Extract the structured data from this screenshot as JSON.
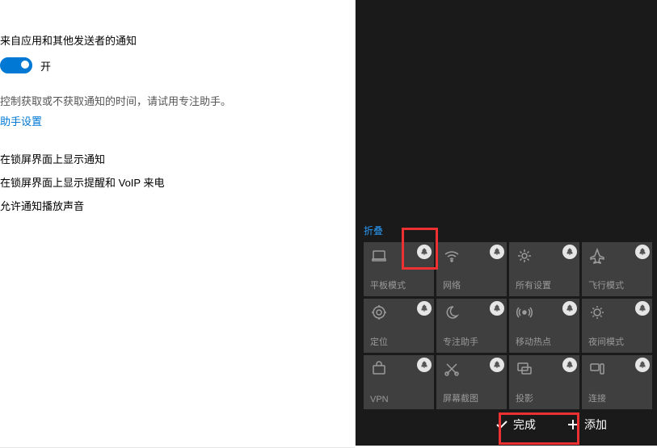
{
  "settings": {
    "notif_sources": "来自应用和其他发送者的通知",
    "toggle_state": "开",
    "focus_assist_desc": "控制获取或不获取通知的时间，请试用专注助手。",
    "focus_assist_link": "助手设置",
    "lock_notif": "在锁屏界面上显示通知",
    "lock_reminder": "在锁屏界面上显示提醒和 VoIP 来电",
    "sound_notif": "允许通知播放声音"
  },
  "action_center": {
    "collapse": "折叠",
    "tiles": [
      {
        "label": "平板模式",
        "icon": "tablet"
      },
      {
        "label": "网络",
        "icon": "wifi"
      },
      {
        "label": "所有设置",
        "icon": "gear"
      },
      {
        "label": "飞行模式",
        "icon": "airplane"
      },
      {
        "label": "定位",
        "icon": "location"
      },
      {
        "label": "专注助手",
        "icon": "moon"
      },
      {
        "label": "移动热点",
        "icon": "hotspot"
      },
      {
        "label": "夜间模式",
        "icon": "night"
      },
      {
        "label": "VPN",
        "icon": "vpn"
      },
      {
        "label": "屏幕截图",
        "icon": "snip"
      },
      {
        "label": "投影",
        "icon": "project"
      },
      {
        "label": "连接",
        "icon": "connect"
      }
    ],
    "done": "完成",
    "add": "添加"
  }
}
